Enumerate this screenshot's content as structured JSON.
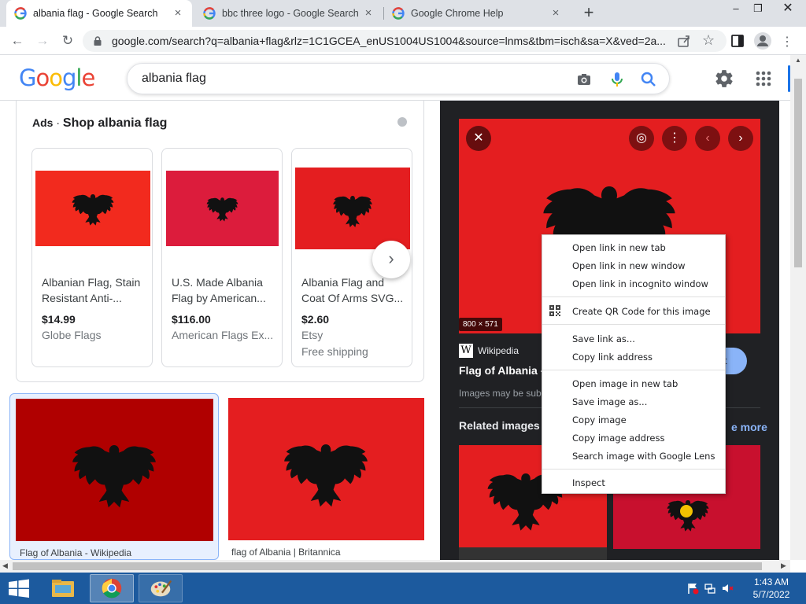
{
  "browser": {
    "tabs": [
      {
        "title": "albania flag - Google Search",
        "active": true
      },
      {
        "title": "bbc three logo - Google Search",
        "active": false
      },
      {
        "title": "Google Chrome Help",
        "active": false
      }
    ],
    "new_tab": "+",
    "window_controls": {
      "minimize": "–",
      "maximize": "❐",
      "close": "✕"
    },
    "url": "google.com/search?q=albania+flag&rlz=1C1GCEA_enUS1004US1004&source=lnms&tbm=isch&sa=X&ved=2a..."
  },
  "google": {
    "logo": [
      {
        "ch": "G",
        "color": "#4285F4"
      },
      {
        "ch": "o",
        "color": "#EA4335"
      },
      {
        "ch": "o",
        "color": "#FBBC05"
      },
      {
        "ch": "g",
        "color": "#4285F4"
      },
      {
        "ch": "l",
        "color": "#34A853"
      },
      {
        "ch": "e",
        "color": "#EA4335"
      }
    ],
    "query": "albania flag"
  },
  "ads": {
    "label": "Ads",
    "separator": "·",
    "title": "Shop albania flag",
    "products": [
      {
        "title": "Albanian Flag, Stain Resistant Anti-...",
        "price": "$14.99",
        "seller": "Globe Flags",
        "shipping": ""
      },
      {
        "title": "U.S. Made Albania Flag by American...",
        "price": "$116.00",
        "seller": "American Flags Ex...",
        "shipping": ""
      },
      {
        "title": "Albania Flag and Coat Of Arms SVG...",
        "price": "$2.60",
        "seller": "Etsy",
        "shipping": "Free shipping"
      }
    ]
  },
  "results": [
    {
      "caption": "Flag of Albania - Wikipedia"
    },
    {
      "caption": "flag of Albania | Britannica"
    }
  ],
  "preview": {
    "dimensions": "800 × 571",
    "source": "Wikipedia",
    "title": "Flag of Albania -",
    "visit_label": "it",
    "note": "Images may be sub",
    "related_title": "Related images",
    "see_more": "e more"
  },
  "context_menu": {
    "groups": [
      [
        "Open link in new tab",
        "Open link in new window",
        "Open link in incognito window"
      ],
      [
        "Create QR Code for this image"
      ],
      [
        "Save link as...",
        "Copy link address"
      ],
      [
        "Open image in new tab",
        "Save image as...",
        "Copy image",
        "Copy image address",
        "Search image with Google Lens"
      ],
      [
        "Inspect"
      ]
    ]
  },
  "taskbar": {
    "time": "1:43 AM",
    "date": "5/7/2022"
  },
  "colors": {
    "flag_red": "#e41e20",
    "flag_dark_red": "#b00000",
    "accent_blue": "#1a73e8",
    "taskbar": "#1c5a9e"
  }
}
